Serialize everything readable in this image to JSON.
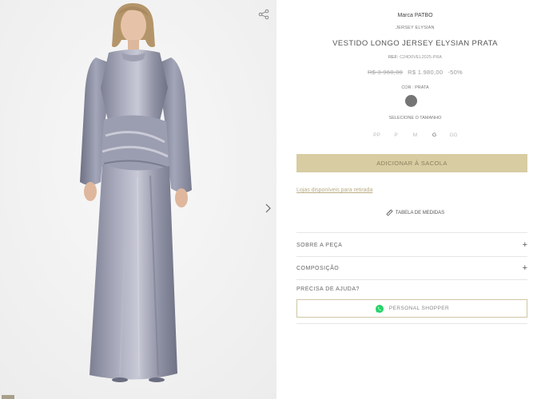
{
  "gallery": {
    "share_icon": "share-icon",
    "next_icon": "chevron-right-icon"
  },
  "product": {
    "brand": "Marca PATBO",
    "collection": "JERSEY ELYSIAN",
    "title": "VESTIDO LONGO JERSEY ELYSIAN PRATA",
    "ref_label": "REF: ",
    "ref_code": "C24D0VEL2025-PRA",
    "price_old": "R$ 3.960,00",
    "price_new": "R$ 1.980,00",
    "discount": "-50%",
    "color_label": "COR : PRATA",
    "color_swatch": "#757575",
    "size_label": "SELECIONE O TAMANHO",
    "sizes": [
      {
        "label": "PP",
        "available": false
      },
      {
        "label": "P",
        "available": false
      },
      {
        "label": "M",
        "available": false
      },
      {
        "label": "G",
        "available": true
      },
      {
        "label": "GG",
        "available": false
      }
    ],
    "add_to_bag": "ADICIONAR À SACOLA",
    "stores_link": "Lojas disponíveis para retirada",
    "size_table": "TABELA DE MEDIDAS"
  },
  "accordions": [
    {
      "label": "SOBRE A PEÇA",
      "icon": "+"
    },
    {
      "label": "COMPOSIÇÃO",
      "icon": "+"
    }
  ],
  "help": {
    "label": "PRECISA DE AJUDA?",
    "shopper_button": "PERSONAL SHOPPER",
    "shopper_icon": "whatsapp-icon"
  },
  "colors": {
    "accent_gold": "#d8cca2",
    "link_gold": "#b9ac82",
    "whatsapp_green": "#25d366"
  }
}
